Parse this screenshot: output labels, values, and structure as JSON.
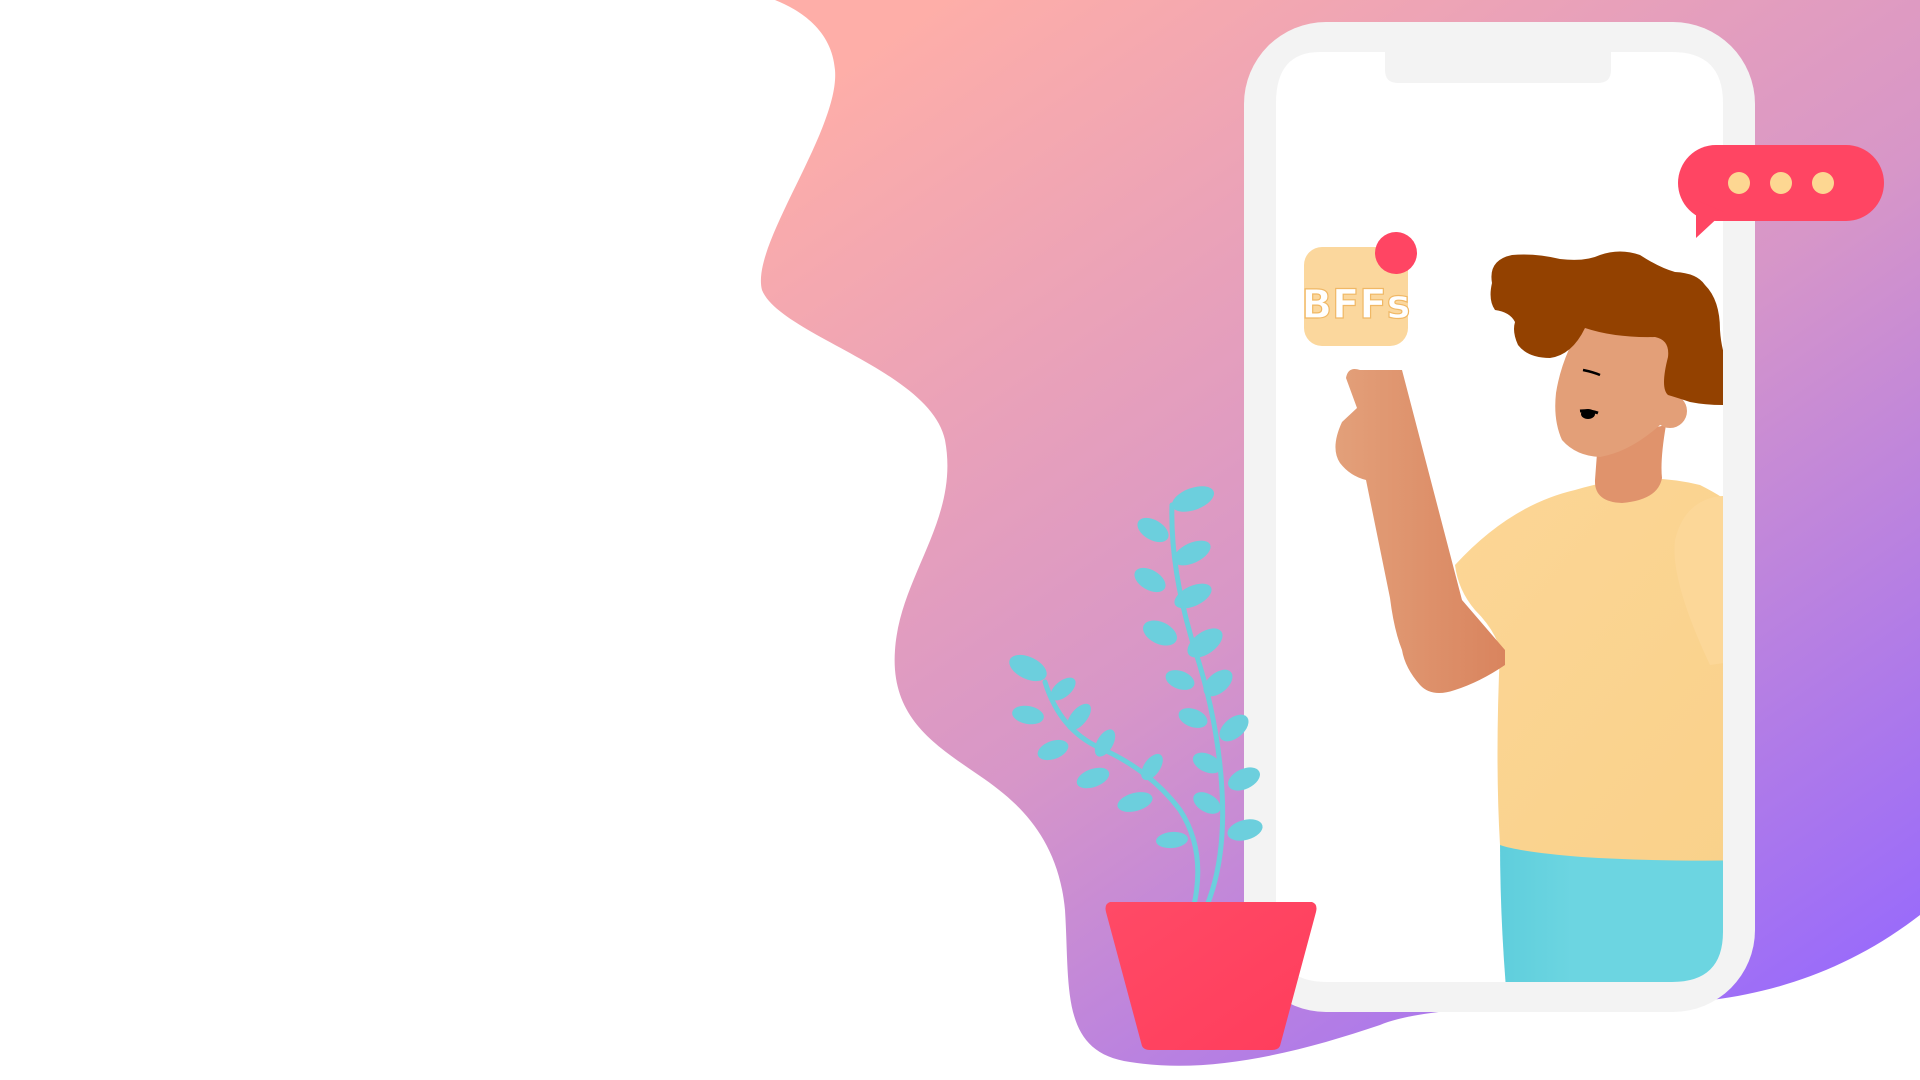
{
  "illustration": {
    "app_icon": {
      "label": "BFFs"
    },
    "chat_bubble": {
      "dots": 3
    }
  },
  "colors": {
    "gradient_start": "#FEAEA8",
    "gradient_mid": "#D796C8",
    "gradient_end": "#9568FE",
    "phone_frame": "#F3F3F3",
    "phone_screen": "#FFFFFF",
    "accent_red": "#FF4563",
    "dot_yellow": "#FDD792",
    "app_icon_bg": "#FBD79D",
    "hair": "#934100",
    "skin": "#E39F78",
    "skin_shadow": "#DC8B62",
    "shirt": "#FBD597",
    "pants": "#6BD5E0",
    "plant": "#6CCFDD",
    "pot": "#FF4563"
  },
  "icons": [
    "chat-bubble-icon",
    "notification-dot-icon",
    "plant-icon",
    "person-icon",
    "phone-icon"
  ]
}
